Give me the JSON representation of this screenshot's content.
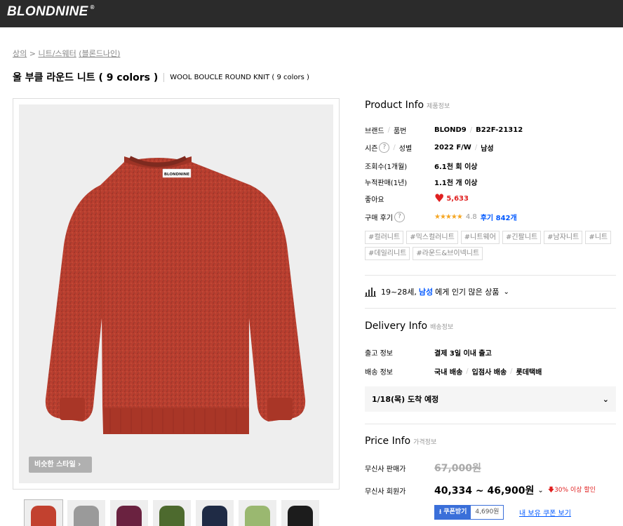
{
  "header": {
    "logo": "BLONDNINE",
    "registered_mark": "®"
  },
  "breadcrumb": {
    "cat1": "상의",
    "sep": " > ",
    "cat2": "니트/스웨터",
    "brand": "(블론드나인)"
  },
  "product": {
    "title_ko": "울 부클 라운드 니트 ( 9 colors )",
    "title_en": "WOOL BOUCLE ROUND KNIT ( 9 colors )",
    "similar_style_button": "비슷한 스타일 ›",
    "knit_tag_text": "BLONDNINE",
    "main_color": "#b83e2f"
  },
  "thumbnails": [
    "#c2412f",
    "#9a9a9a",
    "#6a2240",
    "#4d6a2e",
    "#1f2b45",
    "#9ab870",
    "#1c1c1c"
  ],
  "info": {
    "title": "Product Info",
    "subtitle": "제품정보",
    "brand_label": "브랜드",
    "code_label": "품번",
    "brand": "BLOND9",
    "code": "B22F-21312",
    "season_label": "시즌",
    "gender_label": "성별",
    "season": "2022 F/W",
    "gender": "남성",
    "views_label": "조회수(1개월)",
    "views": "6.1천 회 이상",
    "sales_label": "누적판매(1년)",
    "sales": "1.1천 개 이상",
    "likes_label": "좋아요",
    "likes": "5,633",
    "review_label": "구매 후기",
    "stars": "★★★★★",
    "rating": "4.8",
    "reviews": "후기 842개",
    "help_icon": "?"
  },
  "tags": [
    "#컬러니트",
    "#믹스컬러니트",
    "#니트웨어",
    "#긴팔니트",
    "#남자니트",
    "#니트",
    "#데일리니트",
    "#라운드&브이넥니트"
  ],
  "popularity": {
    "age": "19~28세,",
    "gender": "남성",
    "suffix": "에게 인기 많은 상품",
    "chevron": "⌄"
  },
  "delivery": {
    "title": "Delivery Info",
    "subtitle": "배송정보",
    "ship_label": "출고 정보",
    "ship_value": "결제 3일 이내 출고",
    "method_label": "배송 정보",
    "method_1": "국내 배송",
    "method_2": "입점사 배송",
    "method_3": "롯데택배",
    "arrival": "1/18(목) 도착 예정",
    "arrival_chevron": "⌄"
  },
  "price": {
    "title": "Price Info",
    "subtitle": "가격정보",
    "sale_label": "무신사 판매가",
    "sale_price": "67,000원",
    "member_label": "무신사 회원가",
    "member_price": "40,334 ~ 46,900원",
    "member_chevron": "⌄",
    "discount": "🡇30% 이상 할인",
    "coupon_label": "⭳ 쿠폰받기",
    "coupon_value": "4,690원",
    "my_coupon": "내 보유 쿠폰 보기"
  }
}
